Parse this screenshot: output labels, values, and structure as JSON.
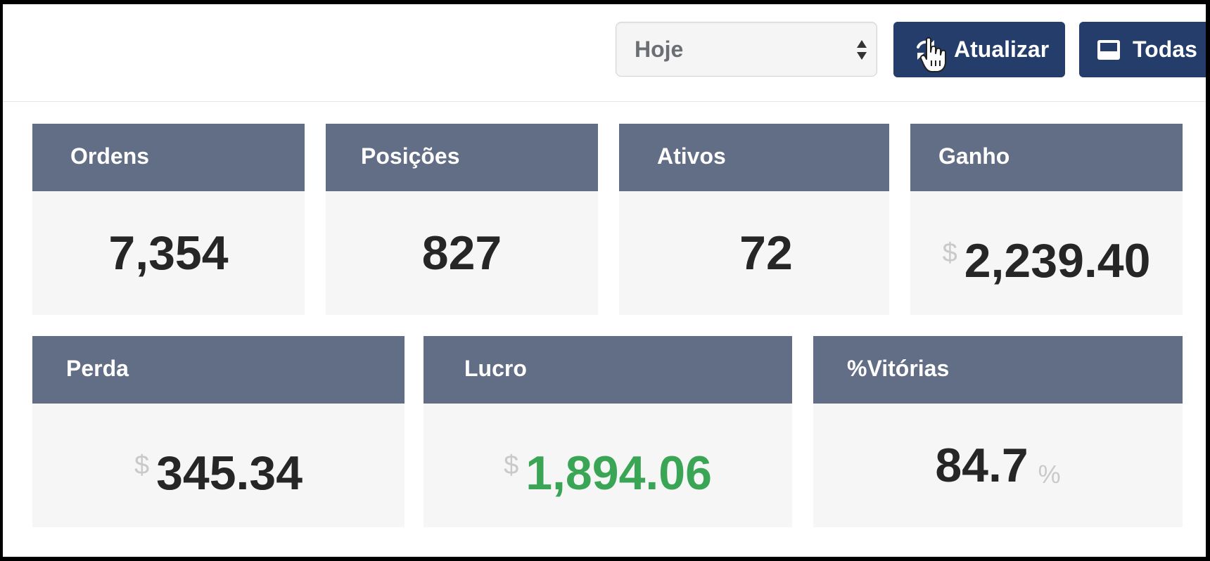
{
  "toolbar": {
    "period": {
      "selected": "Hoje",
      "icon": "sort-arrows-icon"
    },
    "refresh_button": {
      "label": "Atualizar",
      "icon": "refresh-icon"
    },
    "all_button": {
      "label": "Todas",
      "icon": "monitor-icon"
    },
    "cursor_icon": "hand-pointer-icon"
  },
  "colors": {
    "header_bg": "#626d86",
    "button_bg": "#243d6a",
    "profit_green": "#3aa655",
    "card_bg": "#f6f6f6"
  },
  "stats": {
    "orders": {
      "title": "Ordens",
      "value": "7,354"
    },
    "positions": {
      "title": "Posições",
      "value": "827"
    },
    "assets": {
      "title": "Ativos",
      "value": "72"
    },
    "gain": {
      "title": "Ganho",
      "currency": "$",
      "value": "2,239.40"
    },
    "loss": {
      "title": "Perda",
      "currency": "$",
      "value": "345.34"
    },
    "profit": {
      "title": "Lucro",
      "currency": "$",
      "value": "1,894.06"
    },
    "win_rate": {
      "title": "%Vitórias",
      "value": "84.7",
      "unit": "%"
    }
  }
}
